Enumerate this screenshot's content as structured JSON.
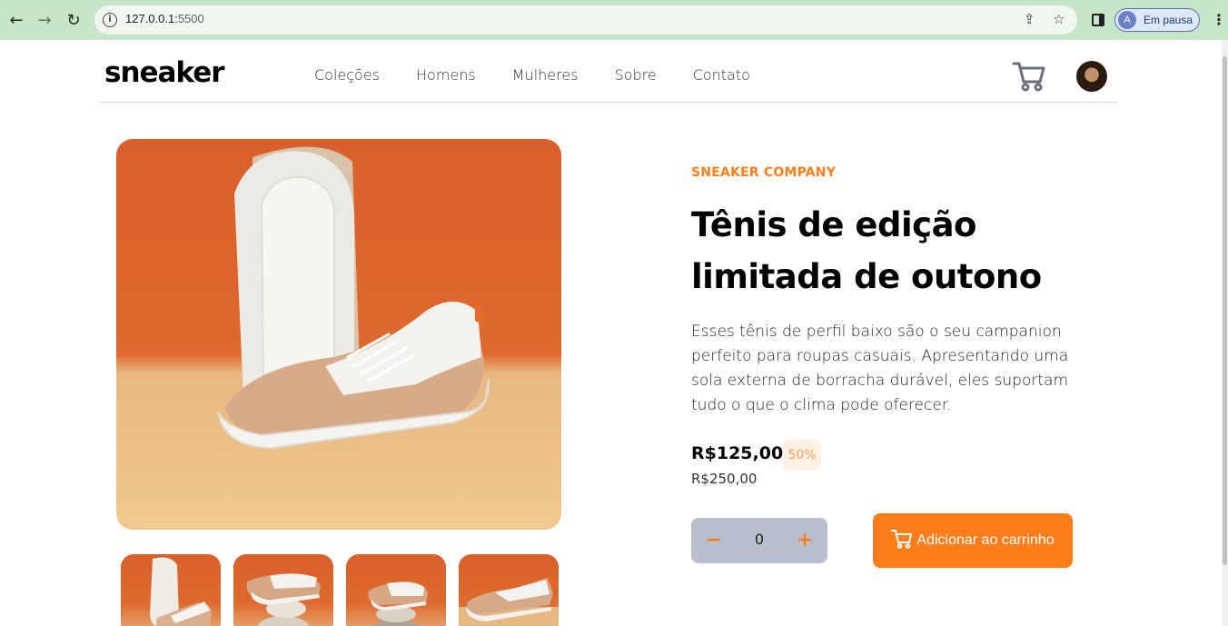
{
  "browser": {
    "url_host": "127.0.0.1:",
    "url_port": "5500",
    "profile_initial": "A",
    "profile_status": "Em pausa"
  },
  "header": {
    "logo": "sneaker",
    "menu": [
      "Coleções",
      "Homens",
      "Mulheres",
      "Sobre",
      "Contato"
    ]
  },
  "product": {
    "company": "SNEAKER COMPANY",
    "title": "Tênis de edição limitada de outono",
    "description": "Esses tênis de perfil baixo são o seu campanion perfeito para roupas casuais. Apresentando uma sola externa de borracha durável, eles suportam tudo o que o clima pode oferecer.",
    "price": "R$125,00",
    "discount": "50%",
    "old_price": "R$250,00",
    "quantity": "0",
    "add_to_cart": "Adicionar ao carrinho"
  },
  "colors": {
    "accent": "#ff7e1b",
    "quantity_bg": "#b8becb"
  }
}
